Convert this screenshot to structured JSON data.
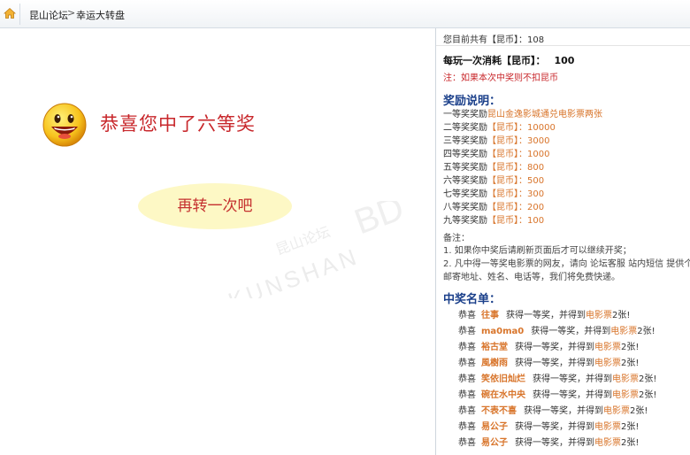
{
  "breadcrumb": {
    "items": [
      "昆山论坛",
      "幸运大转盘"
    ],
    "separator": ">"
  },
  "icons": {
    "home": "home-icon",
    "smiley": "smiley-icon"
  },
  "result": {
    "message": "恭喜您中了六等奖",
    "again_label": "再转一次吧"
  },
  "watermark": {
    "logo_text": "KUNSHAN",
    "chinese_text": "昆山论坛",
    "mark": "BD"
  },
  "side": {
    "balance": "您目前共有【昆币】：108",
    "cost_label": "每玩一次消耗【昆币】：",
    "cost_value": "100",
    "note": "注：如果本次中奖则不扣昆币",
    "rewards_title": "奖励说明：",
    "rewards": [
      {
        "label": "一等奖奖励",
        "prize": "昆山金逸影城通兑电影票两张"
      },
      {
        "label": "二等奖奖励",
        "prize": "【昆币】：10000"
      },
      {
        "label": "三等奖奖励",
        "prize": "【昆币】：3000"
      },
      {
        "label": "四等奖奖励",
        "prize": "【昆币】：1000"
      },
      {
        "label": "五等奖奖励",
        "prize": "【昆币】：800"
      },
      {
        "label": "六等奖奖励",
        "prize": "【昆币】：500"
      },
      {
        "label": "七等奖奖励",
        "prize": "【昆币】：300"
      },
      {
        "label": "八等奖奖励",
        "prize": "【昆币】：200"
      },
      {
        "label": "九等奖奖励",
        "prize": "【昆币】：100"
      }
    ],
    "remark_title": "备注：",
    "remarks": [
      "1. 如果你中奖后请刷新页面后才可以继续开奖；",
      "2. 凡中得一等奖电影票的网友，请向 论坛客服 站内短信 提供个人",
      "邮寄地址、姓名、电话等，我们将免费快递。"
    ],
    "winners_title": "中奖名单：",
    "winners": [
      {
        "prefix": "恭喜",
        "user": "往事",
        "middle": "获得一等奖，并得到",
        "movie": "电影票",
        "suffix": "2张!"
      },
      {
        "prefix": "恭喜",
        "user": "ma0ma0",
        "middle": "获得一等奖，并得到",
        "movie": "电影票",
        "suffix": "2张!"
      },
      {
        "prefix": "恭喜",
        "user": "裕古堂",
        "middle": "获得一等奖，并得到",
        "movie": "电影票",
        "suffix": "2张!"
      },
      {
        "prefix": "恭喜",
        "user": "風樹雨",
        "middle": "获得一等奖，并得到",
        "movie": "电影票",
        "suffix": "2张!"
      },
      {
        "prefix": "恭喜",
        "user": "笑依旧灿烂",
        "middle": "获得一等奖，并得到",
        "movie": "电影票",
        "suffix": "2张!"
      },
      {
        "prefix": "恭喜",
        "user": "碗在水中央",
        "middle": "获得一等奖，并得到",
        "movie": "电影票",
        "suffix": "2张!"
      },
      {
        "prefix": "恭喜",
        "user": "不表不喜",
        "middle": "获得一等奖，并得到",
        "movie": "电影票",
        "suffix": "2张!"
      },
      {
        "prefix": "恭喜",
        "user": "易公子",
        "middle": "获得一等奖，并得到",
        "movie": "电影票",
        "suffix": "2张!"
      },
      {
        "prefix": "恭喜",
        "user": "易公子",
        "middle": "获得一等奖，并得到",
        "movie": "电影票",
        "suffix": "2张!"
      }
    ]
  }
}
